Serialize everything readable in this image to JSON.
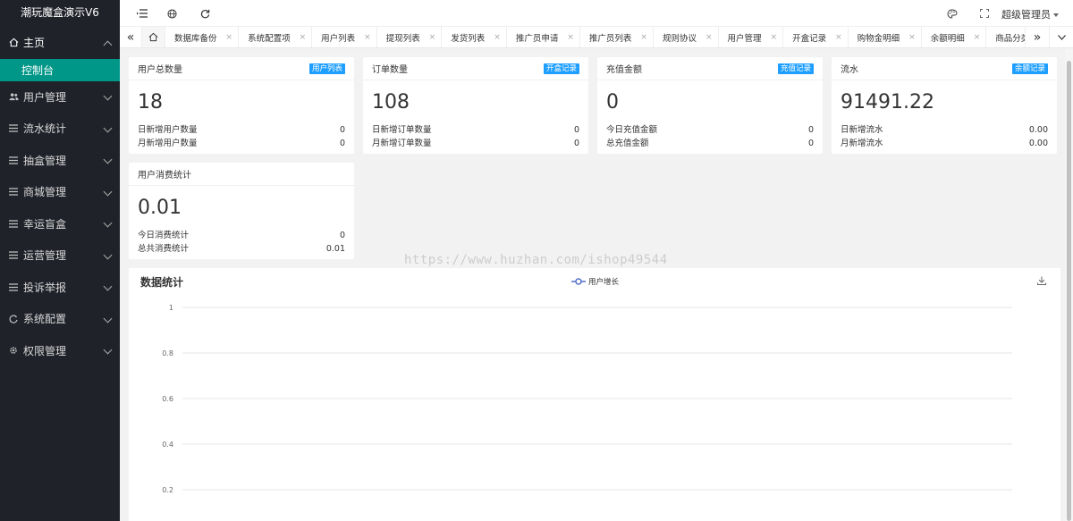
{
  "brand": "潮玩魔盒演示V6",
  "sidebar": {
    "home_label": "主页",
    "sub_active": "控制台",
    "items": [
      {
        "label": "用户管理",
        "icon": "users-icon"
      },
      {
        "label": "流水统计",
        "icon": "list-icon"
      },
      {
        "label": "抽盒管理",
        "icon": "list-icon"
      },
      {
        "label": "商城管理",
        "icon": "list-icon"
      },
      {
        "label": "幸运盲盒",
        "icon": "list-icon"
      },
      {
        "label": "运营管理",
        "icon": "list-icon"
      },
      {
        "label": "投诉举报",
        "icon": "list-icon"
      },
      {
        "label": "系统配置",
        "icon": "refresh-icon"
      },
      {
        "label": "权限管理",
        "icon": "gear-icon"
      }
    ]
  },
  "header": {
    "admin_label": "超级管理员"
  },
  "tabs": [
    "数据库备份",
    "系统配置项",
    "用户列表",
    "提现列表",
    "发货列表",
    "推广员申请",
    "推广员列表",
    "规则协议",
    "用户管理",
    "开盒记录",
    "购物金明细",
    "余额明细",
    "商品分类"
  ],
  "cards": [
    {
      "title": "用户总数量",
      "badge": "用户列表",
      "value": "18",
      "r1_label": "日新增用户数量",
      "r1_value": "0",
      "r2_label": "月新增用户数量",
      "r2_value": "0"
    },
    {
      "title": "订单数量",
      "badge": "开盒记录",
      "value": "108",
      "r1_label": "日新增订单数量",
      "r1_value": "0",
      "r2_label": "月新增订单数量",
      "r2_value": "0"
    },
    {
      "title": "充值金额",
      "badge": "充值记录",
      "value": "0",
      "r1_label": "今日充值金额",
      "r1_value": "0",
      "r2_label": "总充值金额",
      "r2_value": "0"
    },
    {
      "title": "流水",
      "badge": "余额记录",
      "value": "91491.22",
      "r1_label": "日新增流水",
      "r1_value": "0.00",
      "r2_label": "月新增流水",
      "r2_value": "0.00"
    },
    {
      "title": "用户消费统计",
      "badge": "",
      "value": "0.01",
      "r1_label": "今日消费统计",
      "r1_value": "0",
      "r2_label": "总共消费统计",
      "r2_value": "0.01"
    }
  ],
  "watermark": "https://www.huzhan.com/ishop49544",
  "chart_panel": {
    "title": "数据统计"
  },
  "chart_data": {
    "type": "line",
    "title": "",
    "series": [
      {
        "name": "用户增长",
        "values": []
      }
    ],
    "yticks": [
      "1",
      "0.8",
      "0.6",
      "0.4",
      "0.2"
    ],
    "ylim": [
      0,
      1
    ],
    "grid": true,
    "legend": "top-center",
    "accent": "#5470c6"
  },
  "colors": {
    "sidebar": "#20222a",
    "active": "#009688",
    "badge": "#1e9fff"
  }
}
